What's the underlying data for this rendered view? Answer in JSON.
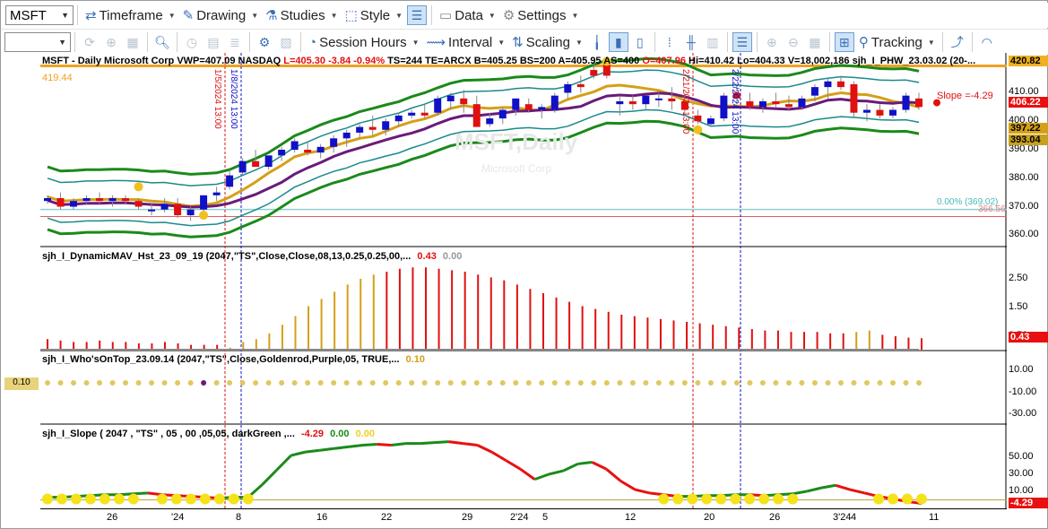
{
  "toolbar1": {
    "symbol": "MSFT",
    "timeframe": "Timeframe",
    "drawing": "Drawing",
    "studies": "Studies",
    "style": "Style",
    "data": "Data",
    "settings": "Settings"
  },
  "toolbar2": {
    "session_hours": "Session Hours",
    "interval": "Interval",
    "scaling": "Scaling",
    "tracking": "Tracking"
  },
  "header": {
    "symbol_line": "MSFT - Daily  Microsoft Corp  VWP=407.09  NASDAQ",
    "last": "L=405.30",
    "change": "-3.84",
    "change_pct": "-0.94%",
    "mid_line": "TS=244  TE=ARCX  B=405.25  BS=200  A=405.95  AS=400",
    "open": "O=407.96",
    "tail_line": "Hi=410.42  Lo=404.33  V=18,002,186  sjh_I_PHW_23.03.02 (20-..."
  },
  "watermark": {
    "title": "MSFT,Daily",
    "sub": "Microsoft Corp"
  },
  "price_panel": {
    "y_ticks": [
      "420.00",
      "410.00",
      "400.00",
      "390.00",
      "380.00",
      "370.00",
      "360.00"
    ],
    "left_label_top": "419.44",
    "slope_label": "Slope =-4.29",
    "pct_label": "0.00% (369.02)",
    "pct_label_sub": "366.56",
    "vline_labels": [
      "1/5/2024 13:00",
      "1/8/2024 13:00",
      "2/21/2024 13:00",
      "2/22/2024 13:00"
    ],
    "right_tags": [
      {
        "text": "420.82",
        "color": "#f0b020"
      },
      {
        "text": "406.22",
        "color": "#ffffff"
      },
      {
        "text": "397.22",
        "color": "#d4a017"
      },
      {
        "text": "393.04",
        "color": "#d4a017"
      }
    ]
  },
  "hist_panel": {
    "title": "sjh_I_DynamicMAV_Hst_23_09_19 (2047,\"TS\",Close,Close,08,13,0.25,0.25,00,...",
    "v1": "0.43",
    "v2": "0.00",
    "y_ticks": [
      "2.50",
      "1.50",
      "0.50"
    ],
    "last_tag": "0.43"
  },
  "whos_panel": {
    "title": "sjh_I_Who'sOnTop_23.09.14 (2047,\"TS\",Close,Goldenrod,Purple,05,  TRUE,...",
    "v1": "0.10",
    "left_tag": "0.10",
    "y_ticks": [
      "10.00",
      "-10.00",
      "-30.00"
    ]
  },
  "slope_panel": {
    "title": "sjh_I_Slope ( 2047 , \"TS\" , 05 , 00 ,05,05, darkGreen ,...",
    "v1": "-4.29",
    "v2": "0.00",
    "v3": "0.00",
    "y_ticks": [
      "50.00",
      "30.00",
      "10.00"
    ],
    "last_tag": "-4.29"
  },
  "x_axis": [
    "26",
    "'24",
    "8",
    "16",
    "22",
    "29",
    "2'24",
    "5",
    "12",
    "20",
    "26",
    "3'24",
    "4",
    "11"
  ],
  "colors": {
    "up": "#1010c8",
    "down": "#e01010",
    "green": "#1a8a1a",
    "teal": "#1a8a8a",
    "gold": "#d4a017",
    "purple": "#6a1a7a",
    "orange": "#f0a020"
  },
  "chart_data": {
    "type": "candlestick",
    "ylim": [
      356,
      424
    ],
    "candles": [
      [
        372,
        374,
        371,
        373
      ],
      [
        373,
        375,
        369,
        370
      ],
      [
        370,
        373,
        369,
        372
      ],
      [
        372,
        374,
        371,
        373
      ],
      [
        373,
        375,
        371,
        372
      ],
      [
        372,
        374,
        370,
        373
      ],
      [
        373,
        374,
        371,
        372
      ],
      [
        372,
        373,
        369,
        370
      ],
      [
        369,
        371,
        367,
        369
      ],
      [
        369,
        373,
        368,
        371
      ],
      [
        371,
        373,
        366,
        367
      ],
      [
        367,
        370,
        365,
        369
      ],
      [
        369,
        374,
        368,
        374
      ],
      [
        374,
        377,
        372,
        375
      ],
      [
        377,
        383,
        376,
        381
      ],
      [
        382,
        387,
        381,
        386
      ],
      [
        386,
        390,
        385,
        384
      ],
      [
        384,
        388,
        383,
        388
      ],
      [
        388,
        391,
        386,
        390
      ],
      [
        390,
        394,
        389,
        393
      ],
      [
        390,
        393,
        388,
        389
      ],
      [
        389,
        392,
        387,
        391
      ],
      [
        391,
        395,
        389,
        394
      ],
      [
        394,
        397,
        391,
        396
      ],
      [
        396,
        399,
        394,
        398
      ],
      [
        398,
        402,
        395,
        397
      ],
      [
        397,
        401,
        395,
        400
      ],
      [
        400,
        403,
        398,
        402
      ],
      [
        402,
        404,
        401,
        403
      ],
      [
        403,
        406,
        401,
        402
      ],
      [
        403,
        409,
        402,
        408
      ],
      [
        407,
        410,
        404,
        409
      ],
      [
        408,
        411,
        403,
        406
      ],
      [
        406,
        409,
        398,
        398
      ],
      [
        399,
        403,
        398,
        401
      ],
      [
        401,
        405,
        399,
        404
      ],
      [
        404,
        408,
        402,
        408
      ],
      [
        406,
        408,
        403,
        404
      ],
      [
        404,
        406,
        401,
        405
      ],
      [
        404,
        410,
        403,
        409
      ],
      [
        410,
        414,
        408,
        413
      ],
      [
        413,
        416,
        410,
        412
      ],
      [
        418,
        421,
        415,
        416
      ],
      [
        421,
        422,
        415,
        416
      ],
      [
        406,
        409,
        402,
        407
      ],
      [
        407,
        409,
        404,
        406
      ],
      [
        406,
        409,
        404,
        409
      ],
      [
        408,
        410,
        405,
        408
      ],
      [
        408,
        412,
        404,
        407
      ],
      [
        407,
        410,
        402,
        404
      ],
      [
        402,
        404,
        399,
        400
      ],
      [
        399,
        402,
        398,
        401
      ],
      [
        401,
        410,
        400,
        409
      ],
      [
        410,
        413,
        406,
        408
      ],
      [
        407,
        410,
        404,
        405
      ],
      [
        405,
        408,
        403,
        407
      ],
      [
        407,
        410,
        405,
        406
      ],
      [
        406,
        409,
        404,
        405
      ],
      [
        405,
        409,
        404,
        408
      ],
      [
        409,
        413,
        407,
        412
      ],
      [
        412,
        415,
        408,
        414
      ],
      [
        414,
        416,
        411,
        412
      ],
      [
        413,
        414,
        401,
        403
      ],
      [
        403,
        406,
        400,
        404
      ],
      [
        404,
        406,
        401,
        402
      ],
      [
        402,
        405,
        401,
        404
      ],
      [
        404,
        410,
        403,
        409
      ],
      [
        408,
        410,
        404,
        405
      ]
    ],
    "hist_values": [
      0.4,
      0.35,
      0.3,
      0.3,
      0.35,
      0.3,
      0.3,
      0.25,
      0.25,
      0.3,
      0.25,
      0.2,
      0.2,
      0.2,
      0.1,
      0.3,
      0.4,
      0.6,
      0.9,
      1.2,
      1.55,
      1.8,
      2.05,
      2.3,
      2.5,
      2.65,
      2.75,
      2.85,
      2.9,
      2.9,
      2.85,
      2.8,
      2.75,
      2.65,
      2.55,
      2.45,
      2.3,
      2.15,
      2.0,
      1.85,
      1.7,
      1.55,
      1.45,
      1.35,
      1.25,
      1.2,
      1.15,
      1.1,
      1.05,
      1.0,
      0.95,
      0.9,
      0.85,
      0.8,
      0.75,
      0.7,
      0.7,
      0.65,
      0.65,
      0.65,
      0.6,
      0.6,
      0.65,
      0.7,
      0.55,
      0.5,
      0.45,
      0.43
    ],
    "slope_values": [
      3,
      3,
      4,
      5,
      6,
      6,
      7,
      8,
      6,
      5,
      4,
      3,
      2,
      3,
      3,
      18,
      35,
      52,
      56,
      58,
      60,
      62,
      64,
      65,
      64,
      66,
      66,
      67,
      68,
      66,
      64,
      56,
      46,
      36,
      24,
      30,
      34,
      42,
      44,
      36,
      22,
      12,
      8,
      6,
      4,
      4,
      5,
      5,
      6,
      6,
      5,
      6,
      7,
      10,
      14,
      17,
      12,
      8,
      4,
      1,
      -2,
      -4.29
    ],
    "x_tick_labels": [
      "26",
      "'24",
      "8",
      "16",
      "22",
      "29",
      "2'24",
      "5",
      "12",
      "20",
      "26",
      "3'24",
      "4",
      "11"
    ]
  }
}
